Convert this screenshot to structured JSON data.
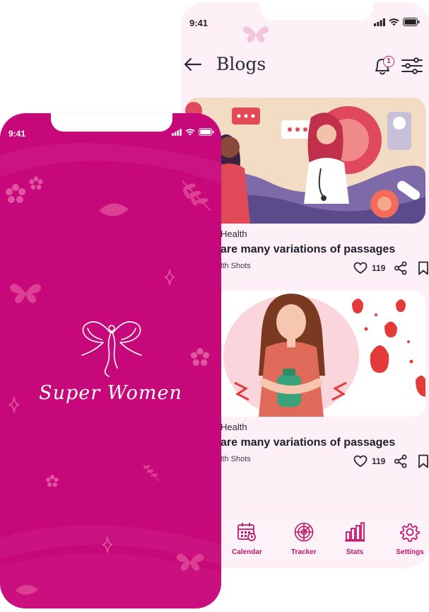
{
  "blogs_screen": {
    "status_time": "9:41",
    "title": "Blogs",
    "notification_count": "1",
    "cards": [
      {
        "category": "Health",
        "title": "are many variations of passages",
        "source": "lth Shots",
        "likes": "119"
      },
      {
        "category": "Health",
        "title": "are many variations of passages",
        "source": "lth Shots",
        "likes": "119"
      }
    ],
    "nav": [
      {
        "label": "Calendar",
        "icon": "calendar-icon"
      },
      {
        "label": "Tracker",
        "icon": "tracker-icon"
      },
      {
        "label": "Stats",
        "icon": "stats-icon"
      },
      {
        "label": "Settings",
        "icon": "gear-icon"
      }
    ]
  },
  "splash_screen": {
    "status_time": "9:41",
    "app_name": "Super Women"
  },
  "colors": {
    "brand": "#c7087a",
    "accent": "#c2166e",
    "blog_bg": "#fdf0f6"
  }
}
